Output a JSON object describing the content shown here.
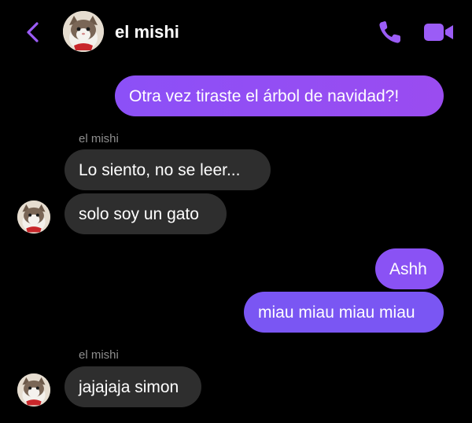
{
  "header": {
    "contact_name": "el mishi",
    "accent_color": "#9b5cf6",
    "icons": [
      "chevron-left-icon",
      "phone-icon",
      "video-camera-icon"
    ]
  },
  "messages": [
    {
      "direction": "outgoing",
      "text": "Otra vez tiraste el árbol de navidad?!"
    },
    {
      "direction": "incoming",
      "sender": "el mishi",
      "text": "Lo siento, no se leer..."
    },
    {
      "direction": "incoming",
      "text": "solo soy un gato"
    },
    {
      "direction": "outgoing",
      "text": "Ashh"
    },
    {
      "direction": "outgoing",
      "text": "miau miau miau miau"
    },
    {
      "direction": "incoming",
      "sender": "el mishi",
      "text": "jajajaja simon"
    }
  ],
  "colors": {
    "background": "#000000",
    "incoming_bubble": "#2e2e2e",
    "outgoing_bubble": "#8c50f7",
    "sender_label": "#8e8e8e"
  }
}
